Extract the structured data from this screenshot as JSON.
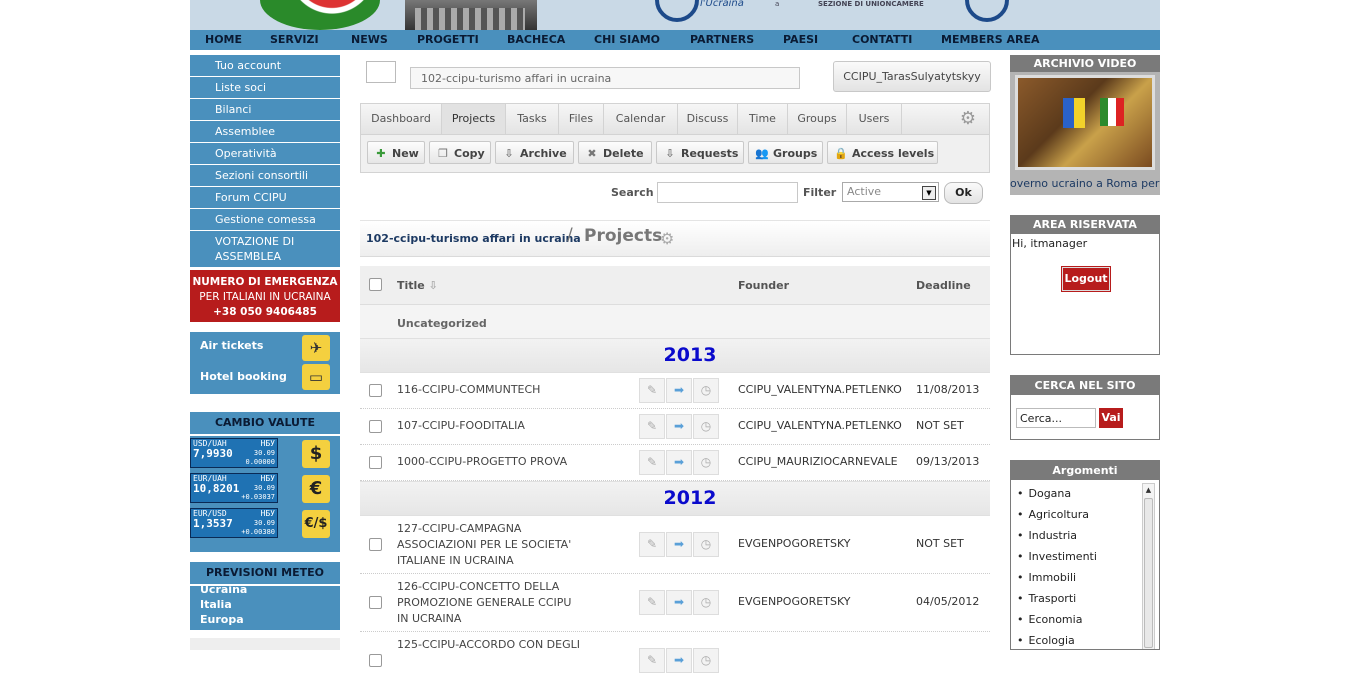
{
  "header": {
    "text_left": "l'Ucraina",
    "text_right": "SEZIONE DI UNIONCAMERE"
  },
  "nav": [
    "HOME",
    "SERVIZI",
    "NEWS",
    "PROGETTI",
    "BACHECA",
    "CHI SIAMO",
    "PARTNERS",
    "PAESI",
    "CONTATTI",
    "MEMBERS AREA"
  ],
  "left_menu": [
    "Tuo account",
    "Liste soci",
    "Bilanci",
    "Assemblee",
    "Operatività",
    "Sezioni consortili",
    "Forum CCIPU",
    "Gestione comessa",
    "VOTAZIONE DI ASSEMBLEA"
  ],
  "emergency": {
    "line1": "NUMERO DI EMERGENZA",
    "line2": "PER ITALIANI IN UCRAINA",
    "phone": "+38 050 9406485"
  },
  "booking": {
    "air": "Air tickets",
    "hotel": "Hotel booking"
  },
  "cambio": {
    "title": "CAMBIO VALUTE",
    "rates": [
      {
        "pair": "USD/UAH",
        "src": "НБУ",
        "value": "7,9930",
        "date": "30.09",
        "change": "0.00000",
        "icon": "$"
      },
      {
        "pair": "EUR/UAH",
        "src": "НБУ",
        "value": "10,8201",
        "date": "30.09",
        "change": "+0.03037",
        "icon": "€"
      },
      {
        "pair": "EUR/USD",
        "src": "НБУ",
        "value": "1,3537",
        "date": "30.09",
        "change": "+0.00380",
        "icon": "€/$"
      }
    ]
  },
  "meteo": {
    "title": "PREVISIONI METEO",
    "items": [
      "Ucraina",
      "Italia",
      "Europa"
    ]
  },
  "main": {
    "project_select": "102-ccipu-turismo affari in ucraina",
    "user_button": "CCIPU_TarasSulyatytskyy",
    "tabs": [
      "Dashboard",
      "Projects",
      "Tasks",
      "Files",
      "Calendar",
      "Discuss",
      "Time",
      "Groups",
      "Users"
    ],
    "actions": [
      "New",
      "Copy",
      "Archive",
      "Delete",
      "Requests",
      "Groups",
      "Access levels"
    ],
    "search_label": "Search",
    "filter_label": "Filter",
    "filter_value": "Active",
    "ok_label": "Ok",
    "crumb_link": "102-ccipu-turismo affari in ucraina",
    "crumb_sep": "/",
    "crumb_title": "Projects",
    "table": {
      "col_title": "Title",
      "col_founder": "Founder",
      "col_deadline": "Deadline",
      "group": "Uncategorized",
      "year1": "2013",
      "year2": "2012",
      "rows_2013": [
        {
          "title": "116-CCIPU-COMMUNTECH",
          "founder": "CCIPU_VALENTYNA.PETLENKO",
          "deadline": "11/08/2013"
        },
        {
          "title": "107-CCIPU-FOODITALIA",
          "founder": "CCIPU_VALENTYNA.PETLENKO",
          "deadline": "NOT SET"
        },
        {
          "title": "1000-CCIPU-PROGETTO PROVA",
          "founder": "CCIPU_MAURIZIOCARNEVALE",
          "deadline": "09/13/2013"
        }
      ],
      "rows_2012": [
        {
          "title1": "127-CCIPU-CAMPAGNA",
          "title2": "ASSOCIAZIONI PER LE SOCIETA'",
          "title3": "ITALIANE IN UCRAINA",
          "founder": "EVGENPOGORETSKY",
          "deadline": "NOT SET"
        },
        {
          "title1": "126-CCIPU-CONCETTO DELLA",
          "title2": "PROMOZIONE GENERALE CCIPU",
          "title3": "IN UCRAINA",
          "founder": "EVGENPOGORETSKY",
          "deadline": "04/05/2012"
        },
        {
          "title1": "125-CCIPU-ACCORDO CON DEGLI",
          "title2": "",
          "title3": "",
          "founder": "",
          "deadline": ""
        }
      ]
    }
  },
  "right": {
    "video_title": "ARCHIVIO VIDEO",
    "video_caption": "overno ucraino a Roma per",
    "area_title": "AREA RISERVATA",
    "greeting": "Hi, itmanager",
    "logout": "Logout",
    "search_title": "CERCA NEL SITO",
    "search_value": "Cerca...",
    "search_btn": "Vai",
    "arg_title": "Argomenti",
    "arguments": [
      "Dogana",
      "Agricoltura",
      "Industria",
      "Investimenti",
      "Immobili",
      "Trasporti",
      "Economia",
      "Ecologia"
    ]
  }
}
